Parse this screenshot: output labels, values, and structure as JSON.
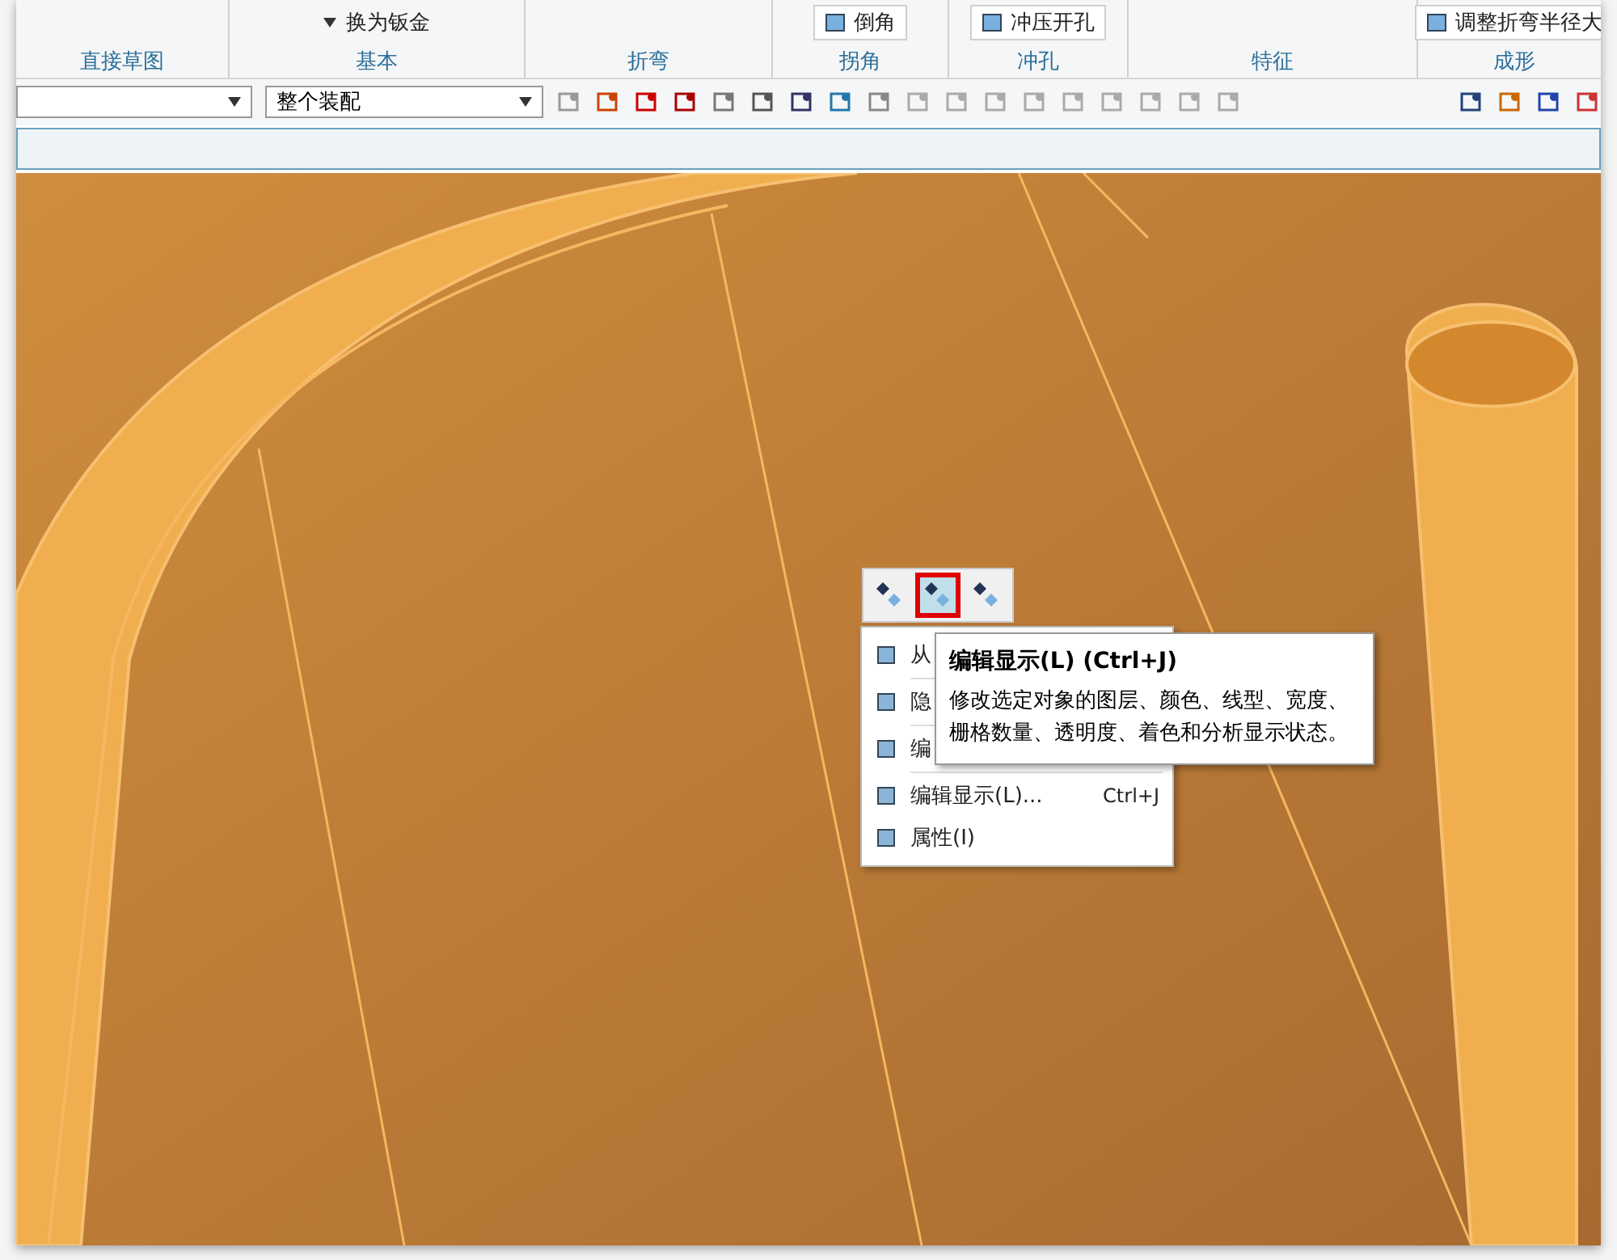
{
  "ribbon": {
    "groups": [
      {
        "label": "直接草图"
      },
      {
        "label": "基本",
        "items": [
          {
            "kind": "caret-text",
            "text": "换为钣金"
          }
        ]
      },
      {
        "label": "折弯"
      },
      {
        "label": "拐角",
        "items": [
          {
            "kind": "command",
            "text": "倒角"
          }
        ]
      },
      {
        "label": "冲孔",
        "items": [
          {
            "kind": "command",
            "text": "冲压开孔"
          }
        ]
      },
      {
        "label": "特征"
      },
      {
        "label": "成形",
        "items": [
          {
            "kind": "command",
            "text": "调整折弯半径大"
          }
        ]
      }
    ]
  },
  "selection_bar": {
    "filter_value": "整个装配"
  },
  "mini_toolbar": [
    {
      "selected": false
    },
    {
      "selected": true
    },
    {
      "selected": false
    }
  ],
  "context_menu": [
    {
      "label": "从"
    },
    {
      "label": "隐"
    },
    {
      "label": "编"
    },
    {
      "label": "编辑显示(L)...",
      "shortcut": "Ctrl+J"
    },
    {
      "label": "属性(I)"
    }
  ],
  "tooltip": {
    "title": "编辑显示(L) (Ctrl+J)",
    "body": "修改选定对象的图层、颜色、线型、宽度、栅格数量、透明度、着色和分析显示状态。"
  }
}
